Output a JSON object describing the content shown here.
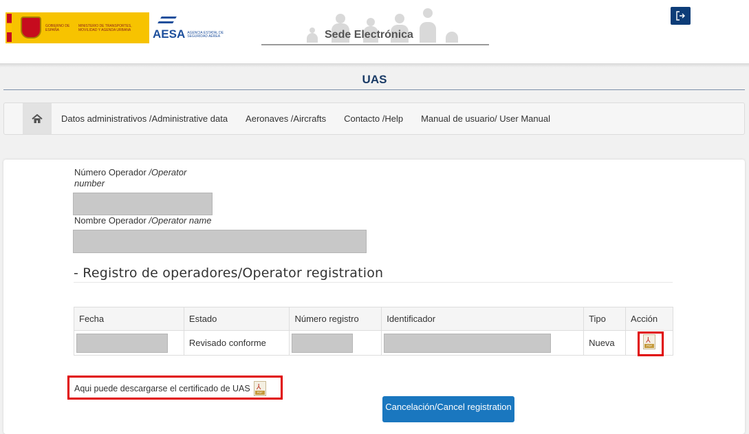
{
  "header": {
    "gov_line1": "GOBIERNO DE ESPAÑA",
    "gov_line2": "MINISTERIO DE TRANSPORTES, MOVILIDAD Y AGENDA URBANA",
    "aesa_mark": "AESA",
    "aesa_sub": "AGENCIA ESTATAL DE SEGURIDAD AÉREA",
    "portal_title": "Sede Electrónica",
    "logout_icon": "logout-icon"
  },
  "app": {
    "title": "UAS"
  },
  "nav": {
    "home_icon": "home-icon",
    "items": [
      "Datos administrativos /Administrative data",
      "Aeronaves /Aircrafts",
      "Contacto /Help",
      "Manual de usuario/ User Manual"
    ]
  },
  "operator": {
    "number_label": "Número Operador ",
    "number_label_en": "/Operator number",
    "name_label": "Nombre Operador ",
    "name_label_en": "/Operator name"
  },
  "registration": {
    "section_title": "- Registro de operadores/Operator registration",
    "columns": [
      "Fecha",
      "Estado",
      "Número registro",
      "Identificador",
      "Tipo",
      "Acción"
    ],
    "rows": [
      {
        "fecha": "",
        "estado": "Revisado conforme",
        "numero_registro": "",
        "identificador": "",
        "tipo": "Nueva",
        "accion_icon": "pdf-icon"
      }
    ]
  },
  "certificate": {
    "text": "Aqui puede descargarse el certificado de UAS",
    "icon": "pdf-icon"
  },
  "cancel_button": {
    "label": "Cancelación/Cancel registration"
  },
  "colors": {
    "accent": "#1a77bf",
    "logout_bg": "#0d3d78",
    "title": "#1a3b66",
    "highlight": "#e00000",
    "redacted": "#c8c8c8"
  }
}
